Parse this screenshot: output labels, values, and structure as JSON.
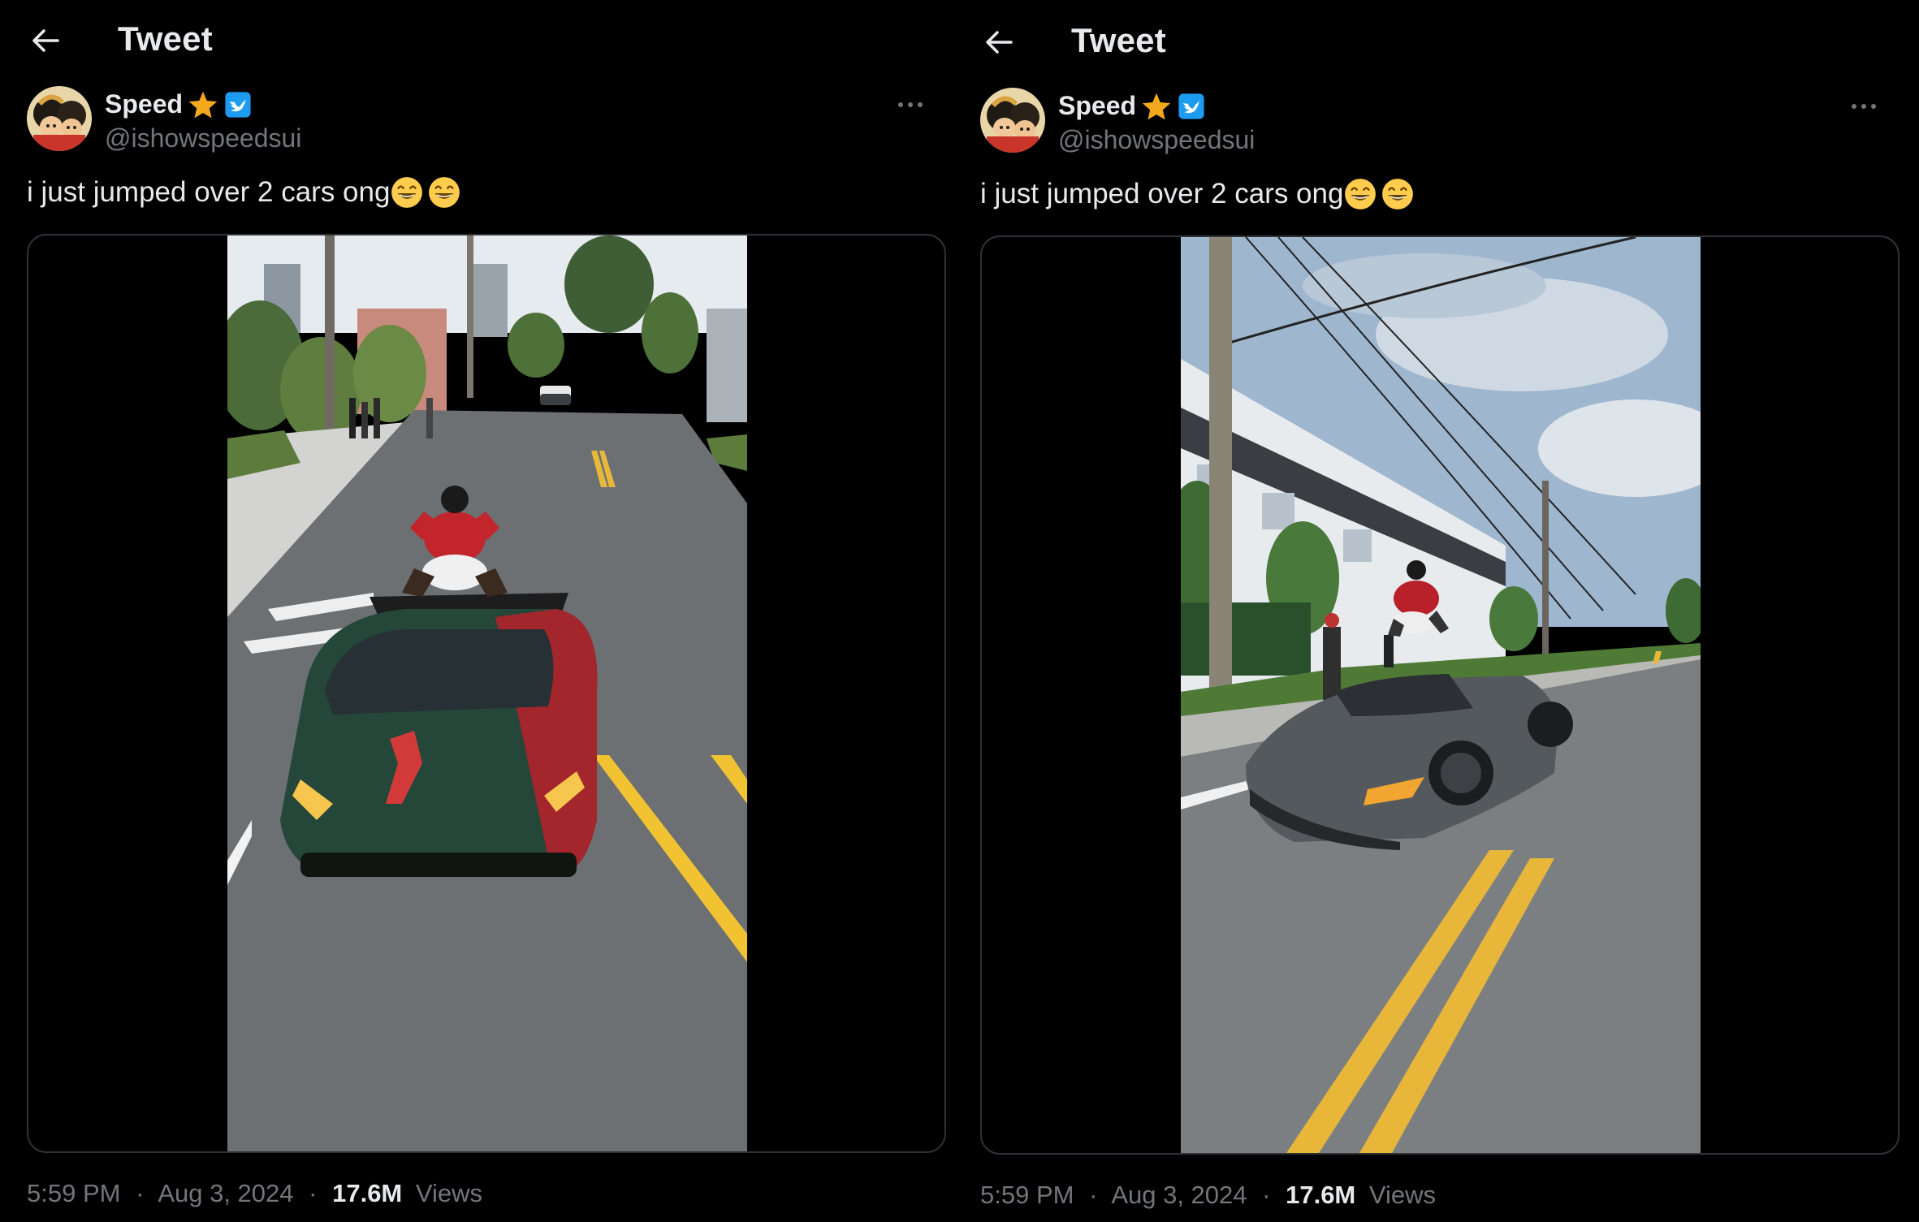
{
  "panels": [
    {
      "topbar": {
        "title": "Tweet"
      },
      "author": {
        "display_name": "Speed",
        "handle": "@ishowspeedsui"
      },
      "tweet": {
        "text": "i just jumped over 2 cars ong"
      },
      "media": {
        "type": "video"
      },
      "meta": {
        "time": "5:59 PM",
        "sep1": "·",
        "date": "Aug 3, 2024",
        "sep2": "·",
        "views_count": "17.6M",
        "views_label": "Views"
      }
    },
    {
      "topbar": {
        "title": "Tweet"
      },
      "author": {
        "display_name": "Speed",
        "handle": "@ishowspeedsui"
      },
      "tweet": {
        "text": "i just jumped over 2 cars ong"
      },
      "media": {
        "type": "video"
      },
      "meta": {
        "time": "5:59 PM",
        "sep1": "·",
        "date": "Aug 3, 2024",
        "sep2": "·",
        "views_count": "17.6M",
        "views_label": "Views"
      }
    }
  ],
  "icons": {
    "back": "arrow-left-icon",
    "more": "more-horizontal-icon",
    "star": "star-icon",
    "verified": "verified-badge-icon",
    "emoji": "grinning-face-emoji"
  },
  "colors": {
    "background": "#000000",
    "text_primary": "#e7e9ea",
    "text_secondary": "#71767b",
    "border": "#2f3336",
    "verified_blue": "#1d9bf0",
    "star_gold": "#f4a81d"
  }
}
